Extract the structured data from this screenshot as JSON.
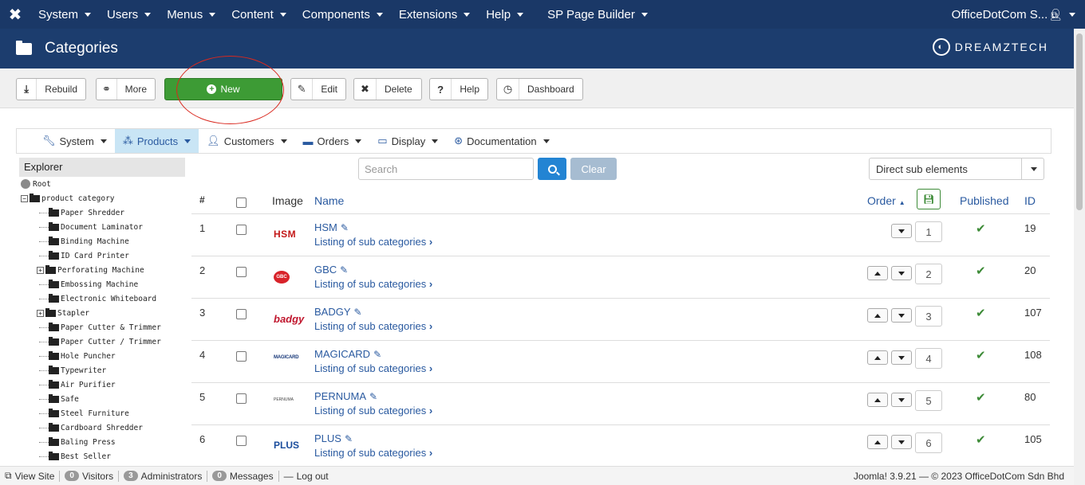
{
  "topbar": {
    "menu": [
      "System",
      "Users",
      "Menus",
      "Content",
      "Components",
      "Extensions",
      "Help",
      "SP Page Builder"
    ],
    "site_name": "OfficeDotCom S...",
    "logo_icon": "joomla-icon",
    "external_icon": "external-link-icon",
    "user_icon": "user-icon"
  },
  "title": {
    "text": "Categories",
    "brand": "DREAMZTECH"
  },
  "toolbar": {
    "rebuild": "Rebuild",
    "more": "More",
    "new": "New",
    "edit": "Edit",
    "delete": "Delete",
    "help": "Help",
    "dashboard": "Dashboard"
  },
  "submenu": {
    "items": [
      {
        "label": "System",
        "icon": "wrench-icon"
      },
      {
        "label": "Products",
        "icon": "cubes-icon",
        "active": true
      },
      {
        "label": "Customers",
        "icon": "user-icon"
      },
      {
        "label": "Orders",
        "icon": "credit-card-icon"
      },
      {
        "label": "Display",
        "icon": "monitor-icon"
      },
      {
        "label": "Documentation",
        "icon": "lifebuoy-icon"
      }
    ]
  },
  "explorer": {
    "title": "Explorer",
    "root": "Root",
    "parent": "product category",
    "children": [
      {
        "label": "Paper Shredder",
        "expandable": false
      },
      {
        "label": "Document Laminator",
        "expandable": false
      },
      {
        "label": "Binding Machine",
        "expandable": false
      },
      {
        "label": "ID Card Printer",
        "expandable": false
      },
      {
        "label": "Perforating Machine",
        "expandable": true
      },
      {
        "label": "Embossing Machine",
        "expandable": false
      },
      {
        "label": "Electronic Whiteboard",
        "expandable": false
      },
      {
        "label": "Stapler",
        "expandable": true
      },
      {
        "label": "Paper Cutter & Trimmer",
        "expandable": false
      },
      {
        "label": "Paper Cutter / Trimmer",
        "expandable": false
      },
      {
        "label": "Hole Puncher",
        "expandable": false
      },
      {
        "label": "Typewriter",
        "expandable": false
      },
      {
        "label": "Air Purifier",
        "expandable": false
      },
      {
        "label": "Safe",
        "expandable": false
      },
      {
        "label": "Steel Furniture",
        "expandable": false
      },
      {
        "label": "Cardboard Shredder",
        "expandable": false
      },
      {
        "label": "Baling Press",
        "expandable": false
      },
      {
        "label": "Best Seller",
        "expandable": false
      }
    ]
  },
  "search": {
    "placeholder": "Search",
    "clear": "Clear",
    "filter": "Direct sub elements"
  },
  "table": {
    "headers": {
      "num": "#",
      "image": "Image",
      "name": "Name",
      "order": "Order",
      "published": "Published",
      "id": "ID"
    },
    "sublink": "Listing of sub categories",
    "rows": [
      {
        "num": "1",
        "name": "HSM",
        "logo": "HSM",
        "order": "1",
        "id": "19",
        "first": true
      },
      {
        "num": "2",
        "name": "GBC",
        "logo": "GBC",
        "order": "2",
        "id": "20",
        "first": false
      },
      {
        "num": "3",
        "name": "BADGY",
        "logo": "badgy",
        "order": "3",
        "id": "107",
        "first": false
      },
      {
        "num": "4",
        "name": "MAGICARD",
        "logo": "MAGICARD",
        "order": "4",
        "id": "108",
        "first": false
      },
      {
        "num": "5",
        "name": "PERNUMA",
        "logo": "PERNUMA",
        "order": "5",
        "id": "80",
        "first": false
      },
      {
        "num": "6",
        "name": "PLUS",
        "logo": "PLUS",
        "order": "6",
        "id": "105",
        "first": false
      }
    ]
  },
  "footer": {
    "view_site": "View Site",
    "visitors_count": "0",
    "visitors": "Visitors",
    "admins_count": "3",
    "admins": "Administrators",
    "messages_count": "0",
    "messages": "Messages",
    "logout": "Log out",
    "copyright": "Joomla! 3.9.21 — © 2023 OfficeDotCom Sdn Bhd"
  }
}
